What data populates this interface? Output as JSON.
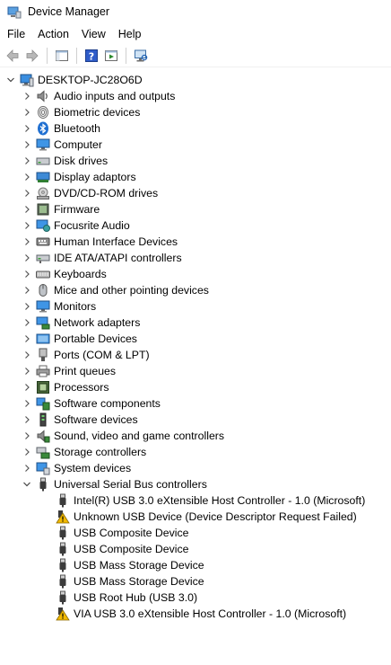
{
  "window": {
    "title": "Device Manager"
  },
  "menubar": {
    "items": [
      "File",
      "Action",
      "View",
      "Help"
    ]
  },
  "tree": {
    "root": "DESKTOP-JC28O6D",
    "categories": [
      {
        "label": "Audio inputs and outputs",
        "icon": "speaker-icon"
      },
      {
        "label": "Biometric devices",
        "icon": "fingerprint-icon"
      },
      {
        "label": "Bluetooth",
        "icon": "bluetooth-icon"
      },
      {
        "label": "Computer",
        "icon": "computer-icon"
      },
      {
        "label": "Disk drives",
        "icon": "disk-drive-icon"
      },
      {
        "label": "Display adaptors",
        "icon": "display-adapter-icon"
      },
      {
        "label": "DVD/CD-ROM drives",
        "icon": "dvd-drive-icon"
      },
      {
        "label": "Firmware",
        "icon": "firmware-icon"
      },
      {
        "label": "Focusrite Audio",
        "icon": "audio-device-icon"
      },
      {
        "label": "Human Interface Devices",
        "icon": "hid-icon"
      },
      {
        "label": "IDE ATA/ATAPI controllers",
        "icon": "ide-controller-icon"
      },
      {
        "label": "Keyboards",
        "icon": "keyboard-icon"
      },
      {
        "label": "Mice and other pointing devices",
        "icon": "mouse-icon"
      },
      {
        "label": "Monitors",
        "icon": "monitor-icon"
      },
      {
        "label": "Network adapters",
        "icon": "network-adapter-icon"
      },
      {
        "label": "Portable Devices",
        "icon": "portable-device-icon"
      },
      {
        "label": "Ports (COM & LPT)",
        "icon": "ports-icon"
      },
      {
        "label": "Print queues",
        "icon": "printer-icon"
      },
      {
        "label": "Processors",
        "icon": "processor-icon"
      },
      {
        "label": "Software components",
        "icon": "software-component-icon"
      },
      {
        "label": "Software devices",
        "icon": "software-device-icon"
      },
      {
        "label": "Sound, video and game controllers",
        "icon": "sound-controller-icon"
      },
      {
        "label": "Storage controllers",
        "icon": "storage-controller-icon"
      },
      {
        "label": "System devices",
        "icon": "system-devices-icon"
      }
    ],
    "expanded_category": {
      "label": "Universal Serial Bus controllers",
      "icon": "usb-icon",
      "devices": [
        {
          "label": "Intel(R) USB 3.0 eXtensible Host Controller - 1.0 (Microsoft)",
          "icon": "usb-icon"
        },
        {
          "label": "Unknown USB Device (Device Descriptor Request Failed)",
          "icon": "warning-icon"
        },
        {
          "label": "USB Composite Device",
          "icon": "usb-icon"
        },
        {
          "label": "USB Composite Device",
          "icon": "usb-icon"
        },
        {
          "label": "USB Mass Storage Device",
          "icon": "usb-icon"
        },
        {
          "label": "USB Mass Storage Device",
          "icon": "usb-icon"
        },
        {
          "label": "USB Root Hub (USB 3.0)",
          "icon": "usb-icon"
        },
        {
          "label": "VIA USB 3.0 eXtensible Host Controller - 1.0 (Microsoft)",
          "icon": "warning-icon"
        }
      ]
    }
  },
  "colors": {
    "accent": "#1e78d7",
    "warning": "#f2b900"
  }
}
